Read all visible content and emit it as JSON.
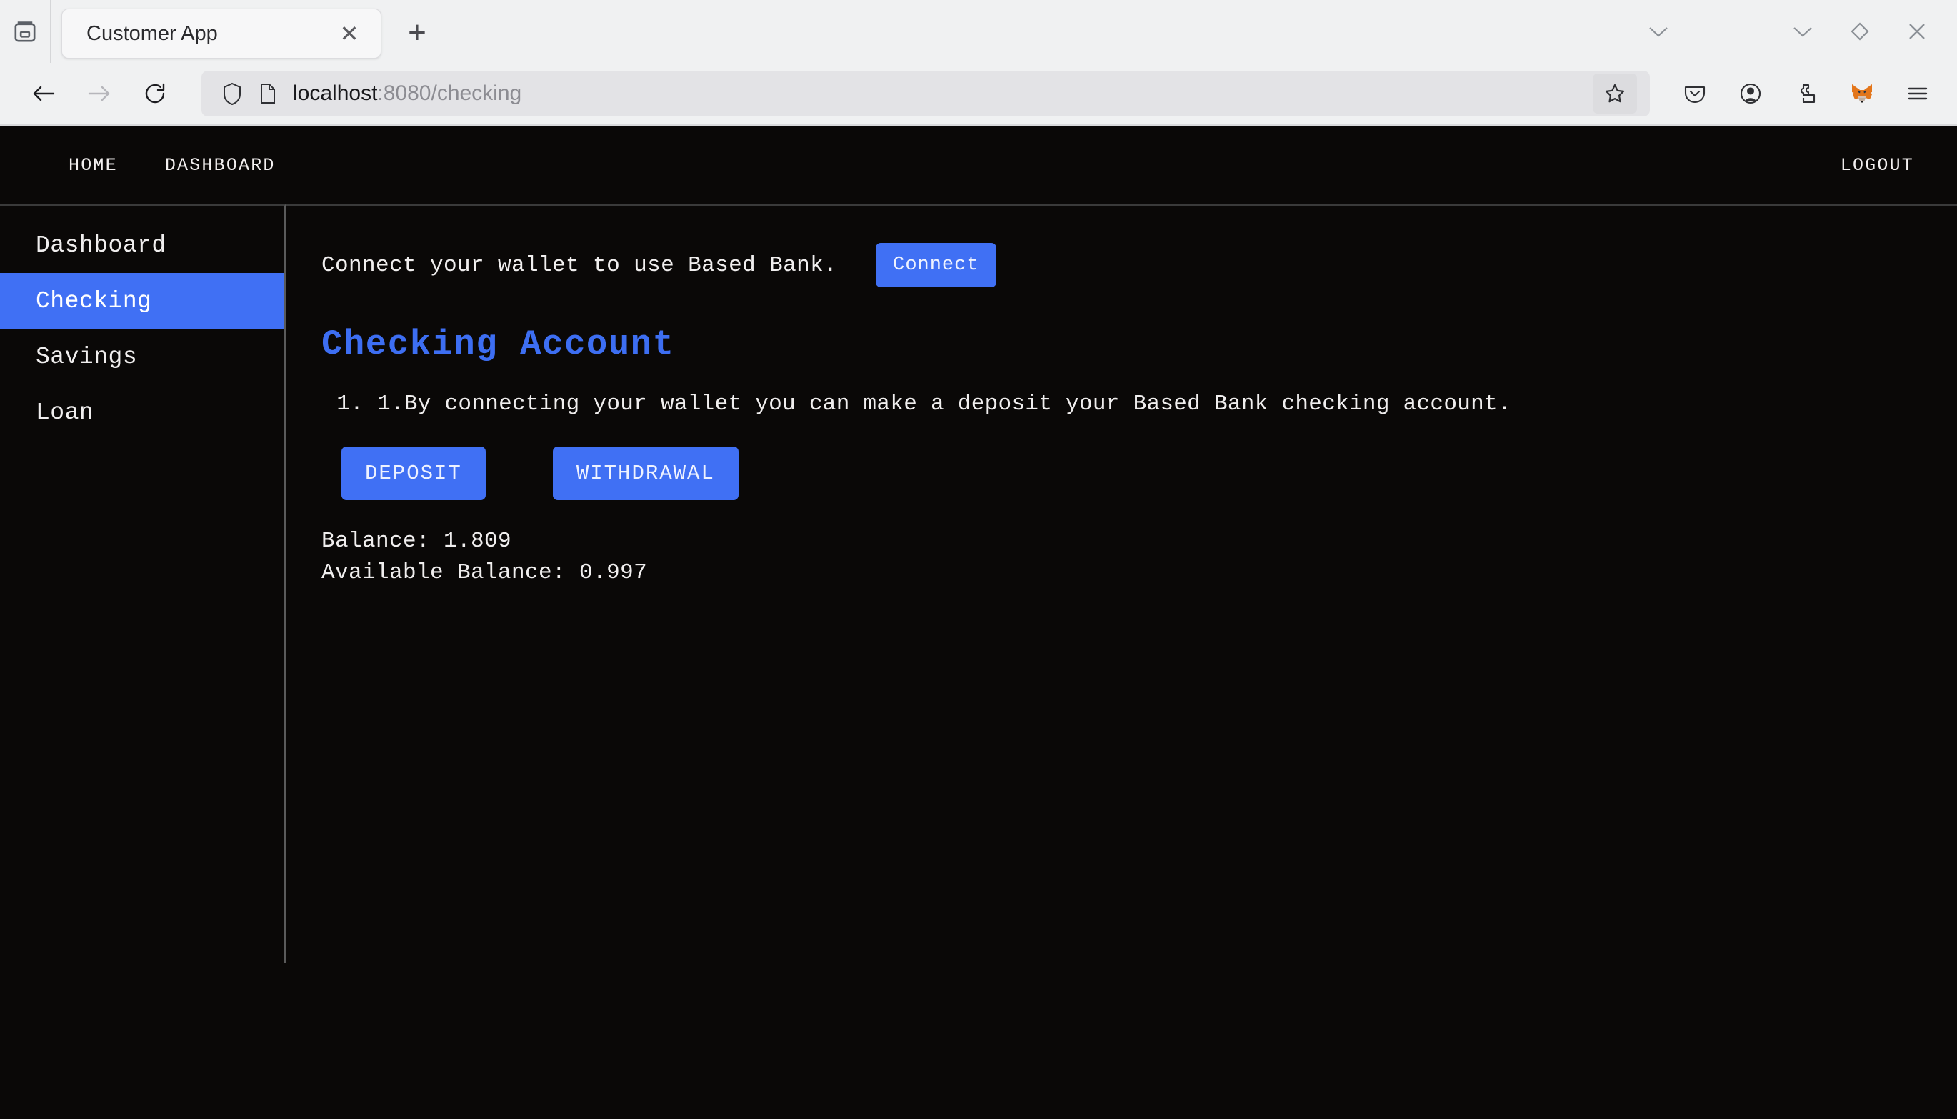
{
  "browser": {
    "firefox_view_icon": "firefox-view-icon",
    "tab": {
      "title": "Customer App",
      "close_label": "✕"
    },
    "new_tab_label": "+",
    "window_controls": {
      "tab_list_label": "⌄",
      "minimize_label": "⌄",
      "maximize_label": "◇",
      "close_label": "✕"
    },
    "nav": {
      "back_label": "←",
      "forward_label": "→",
      "reload_label": "⟳"
    },
    "url": {
      "host": "localhost",
      "path": ":8080/checking",
      "full": "localhost:8080/checking",
      "shield_icon": "shield-icon",
      "page_icon": "page-document-icon",
      "bookmark_icon": "star-icon"
    },
    "toolbar_icons": [
      "pocket-icon",
      "account-icon",
      "extensions-puzzle-icon",
      "metamask-fox-icon",
      "hamburger-menu-icon"
    ]
  },
  "app": {
    "topnav": {
      "home": "HOME",
      "dashboard": "DASHBOARD",
      "logout": "LOGOUT"
    },
    "sidebar": {
      "items": [
        {
          "label": "Dashboard",
          "active": false
        },
        {
          "label": "Checking",
          "active": true
        },
        {
          "label": "Savings",
          "active": false
        },
        {
          "label": "Loan",
          "active": false
        }
      ]
    },
    "main": {
      "connect_prompt": "Connect your wallet to use Based Bank.",
      "connect_button": "Connect",
      "title": "Checking Account",
      "list_items": [
        "1.By connecting your wallet you can make a deposit your Based Bank checking account."
      ],
      "deposit_button": "DEPOSIT",
      "withdrawal_button": "WITHDRAWAL",
      "balance_line": "Balance: 1.809",
      "available_balance_line": "Available Balance: 0.997",
      "balance_value": "1.809",
      "available_balance_value": "0.997"
    }
  },
  "colors": {
    "accent_blue": "#4070f4",
    "heading_blue": "#3d6ef2",
    "page_background": "#0a0807",
    "text": "#f0eeee",
    "chrome_background": "#f0f1f2"
  }
}
